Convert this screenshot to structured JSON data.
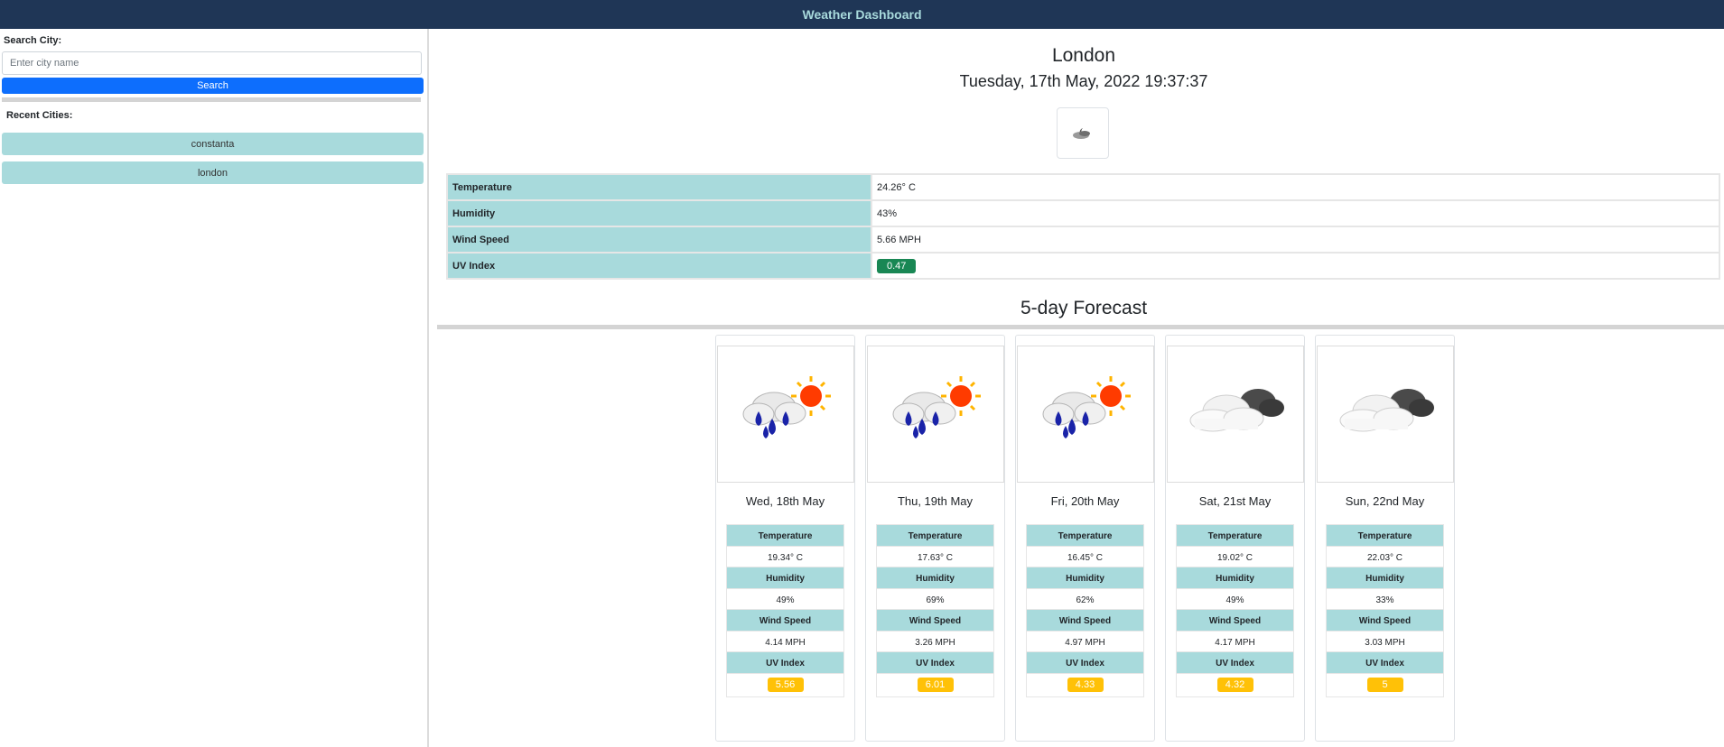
{
  "app": {
    "title": "Weather Dashboard"
  },
  "sidebar": {
    "search_label": "Search City:",
    "search_placeholder": "Enter city name",
    "search_value": "",
    "search_button": "Search",
    "recent_label": "Recent Cities:",
    "recent_cities": [
      "constanta",
      "london"
    ]
  },
  "current": {
    "city": "London",
    "datetime": "Tuesday, 17th May, 2022 19:37:37",
    "icon": "partly-cloudy-night-icon",
    "rows": [
      {
        "label": "Temperature",
        "value": "24.26° C"
      },
      {
        "label": "Humidity",
        "value": "43%"
      },
      {
        "label": "Wind Speed",
        "value": "5.66 MPH"
      },
      {
        "label": "UV Index",
        "value": "0.47"
      }
    ],
    "uv_color": "#198754"
  },
  "forecast": {
    "title": "5-day Forecast",
    "labels": {
      "temp": "Temperature",
      "humidity": "Humidity",
      "wind": "Wind Speed",
      "uv": "UV Index"
    },
    "days": [
      {
        "date": "Wed, 18th May",
        "icon": "rain-sun-icon",
        "temp": "19.34° C",
        "humidity": "49%",
        "wind": "4.14 MPH",
        "uv": "5.56"
      },
      {
        "date": "Thu, 19th May",
        "icon": "rain-sun-icon",
        "temp": "17.63° C",
        "humidity": "69%",
        "wind": "3.26 MPH",
        "uv": "6.01"
      },
      {
        "date": "Fri, 20th May",
        "icon": "rain-sun-icon",
        "temp": "16.45° C",
        "humidity": "62%",
        "wind": "4.97 MPH",
        "uv": "4.33"
      },
      {
        "date": "Sat, 21st May",
        "icon": "broken-clouds-icon",
        "temp": "19.02° C",
        "humidity": "49%",
        "wind": "4.17 MPH",
        "uv": "4.32"
      },
      {
        "date": "Sun, 22nd May",
        "icon": "broken-clouds-icon",
        "temp": "22.03° C",
        "humidity": "33%",
        "wind": "3.03 MPH",
        "uv": "5"
      }
    ],
    "uv_color": "#ffc107"
  },
  "colors": {
    "header_bg": "#1f3656",
    "header_text": "#a8dadc",
    "accent_teal": "#a8dadc",
    "button_blue": "#0d6efd"
  }
}
